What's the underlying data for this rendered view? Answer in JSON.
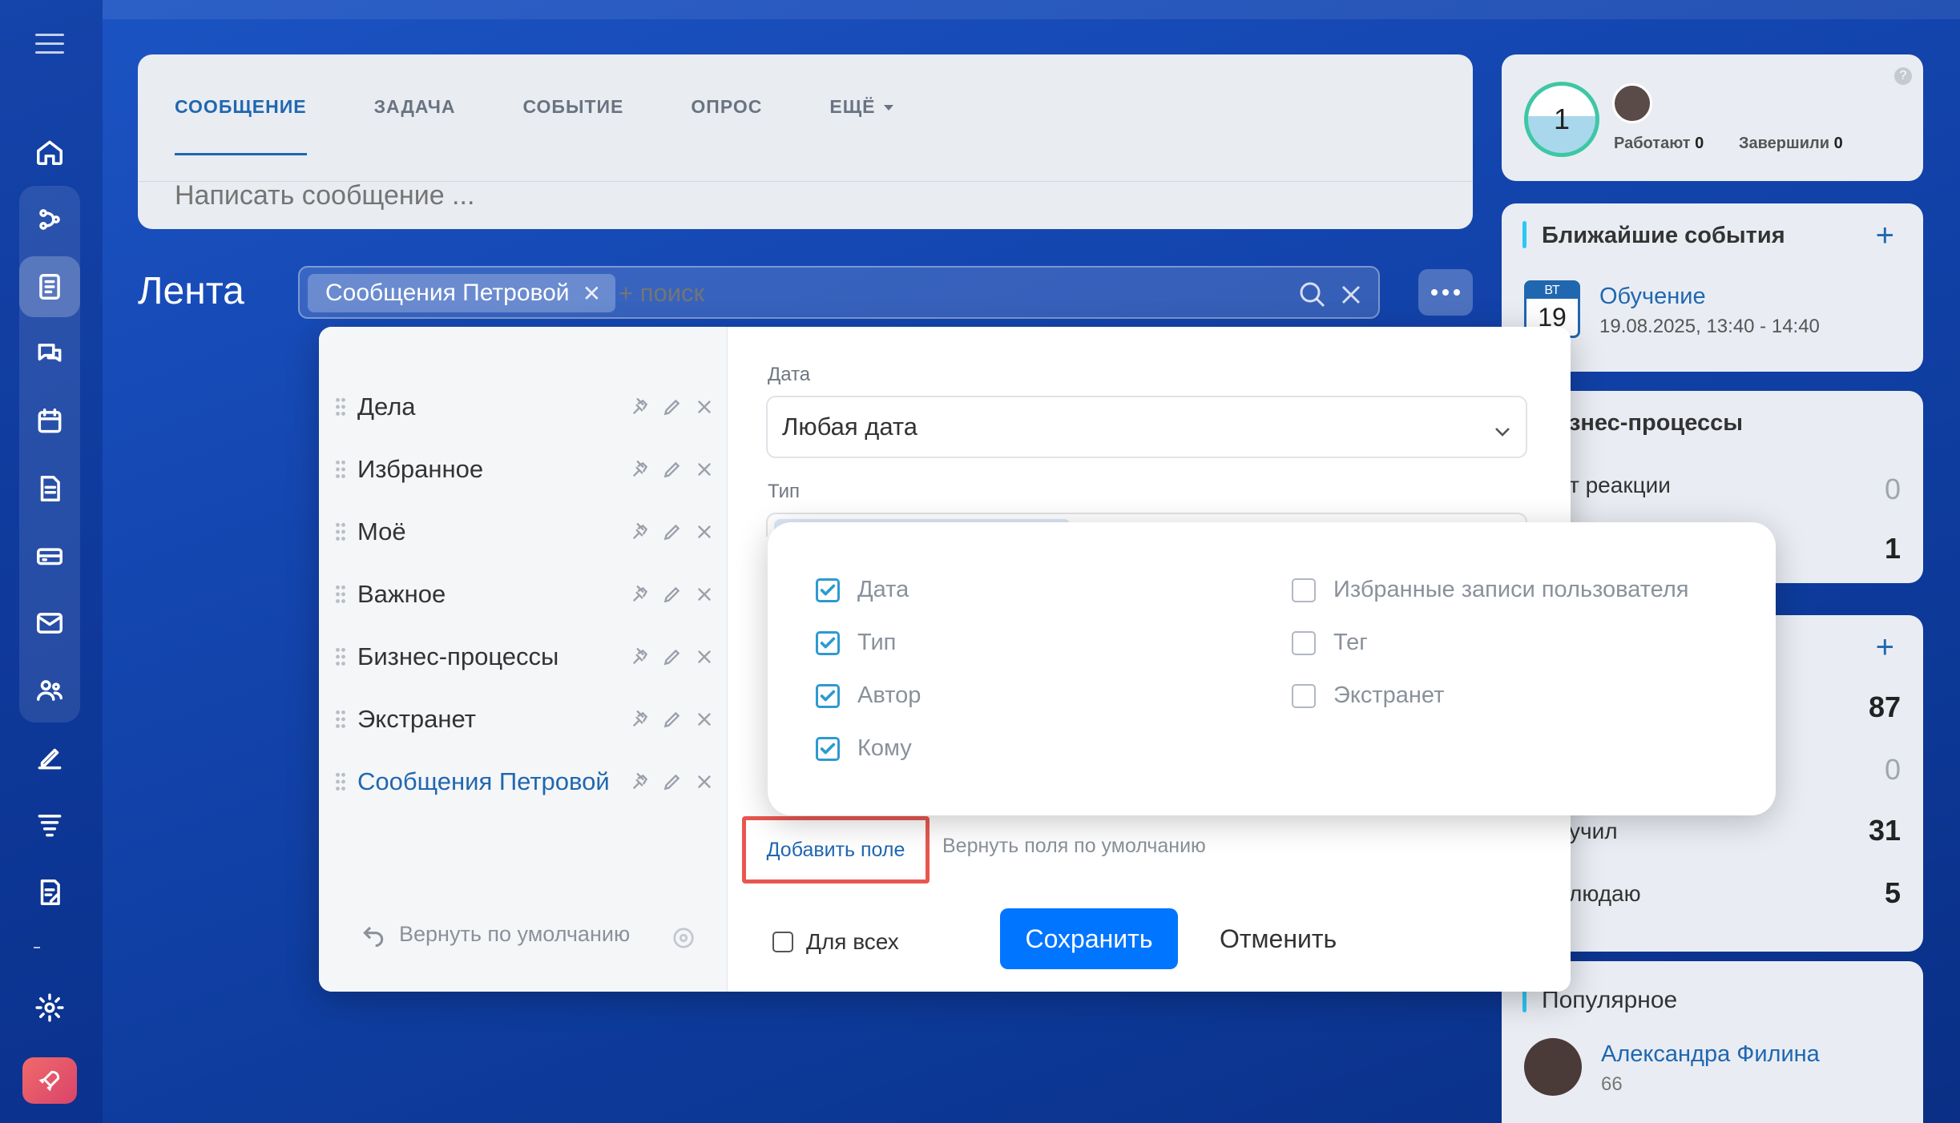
{
  "composer": {
    "tabs": [
      {
        "label": "СООБЩЕНИЕ",
        "active": true
      },
      {
        "label": "ЗАДАЧА"
      },
      {
        "label": "СОБЫТИЕ"
      },
      {
        "label": "ОПРОС"
      },
      {
        "label": "ЕЩЁ"
      }
    ],
    "placeholder": "Написать сообщение ..."
  },
  "feed": {
    "title": "Лента",
    "chip": "Сообщения Петровой",
    "search_placeholder": "+ поиск"
  },
  "right": {
    "workday": {
      "count": "1",
      "working_label": "Работают",
      "working": "0",
      "done_label": "Завершили",
      "done": "0"
    },
    "events": {
      "title": "Ближайшие события",
      "day": "ВТ",
      "date": "19",
      "name": "Обучение",
      "time": "19.08.2025, 13:40 - 14:40"
    },
    "bp": {
      "title": "знес-процессы",
      "row1_label": "т реакции",
      "row1_value": "0",
      "row2_value": "1"
    },
    "tasks": {
      "v1": "87",
      "v2": "0",
      "row3_label": "учил",
      "v3": "31",
      "row4_label": "людаю",
      "v4": "5"
    },
    "popular": {
      "title": "Популярное",
      "name": "Александра Филина",
      "value": "66"
    }
  },
  "filter": {
    "presets": [
      {
        "label": "Дела"
      },
      {
        "label": "Избранное"
      },
      {
        "label": "Моё"
      },
      {
        "label": "Важное"
      },
      {
        "label": "Бизнес-процессы"
      },
      {
        "label": "Экстранет"
      },
      {
        "label": "Сообщения Петровой",
        "active": true
      }
    ],
    "restore_default": "Вернуть по умолчанию",
    "date_label": "Дата",
    "date_value": "Любая дата",
    "type_label": "Тип",
    "add_field": "Добавить поле",
    "restore_fields": "Вернуть поля по умолчанию",
    "for_all": "Для всех",
    "save": "Сохранить",
    "cancel": "Отменить"
  },
  "field_chooser": {
    "left": [
      {
        "label": "Дата",
        "checked": true
      },
      {
        "label": "Тип",
        "checked": true
      },
      {
        "label": "Автор",
        "checked": true
      },
      {
        "label": "Кому",
        "checked": true
      }
    ],
    "right": [
      {
        "label": "Избранные записи пользователя",
        "checked": false
      },
      {
        "label": "Тег",
        "checked": false
      },
      {
        "label": "Экстранет",
        "checked": false
      }
    ]
  },
  "colors": {
    "accent": "#2067b0",
    "primary_button": "#0075ff",
    "highlight": "#e8574f"
  }
}
